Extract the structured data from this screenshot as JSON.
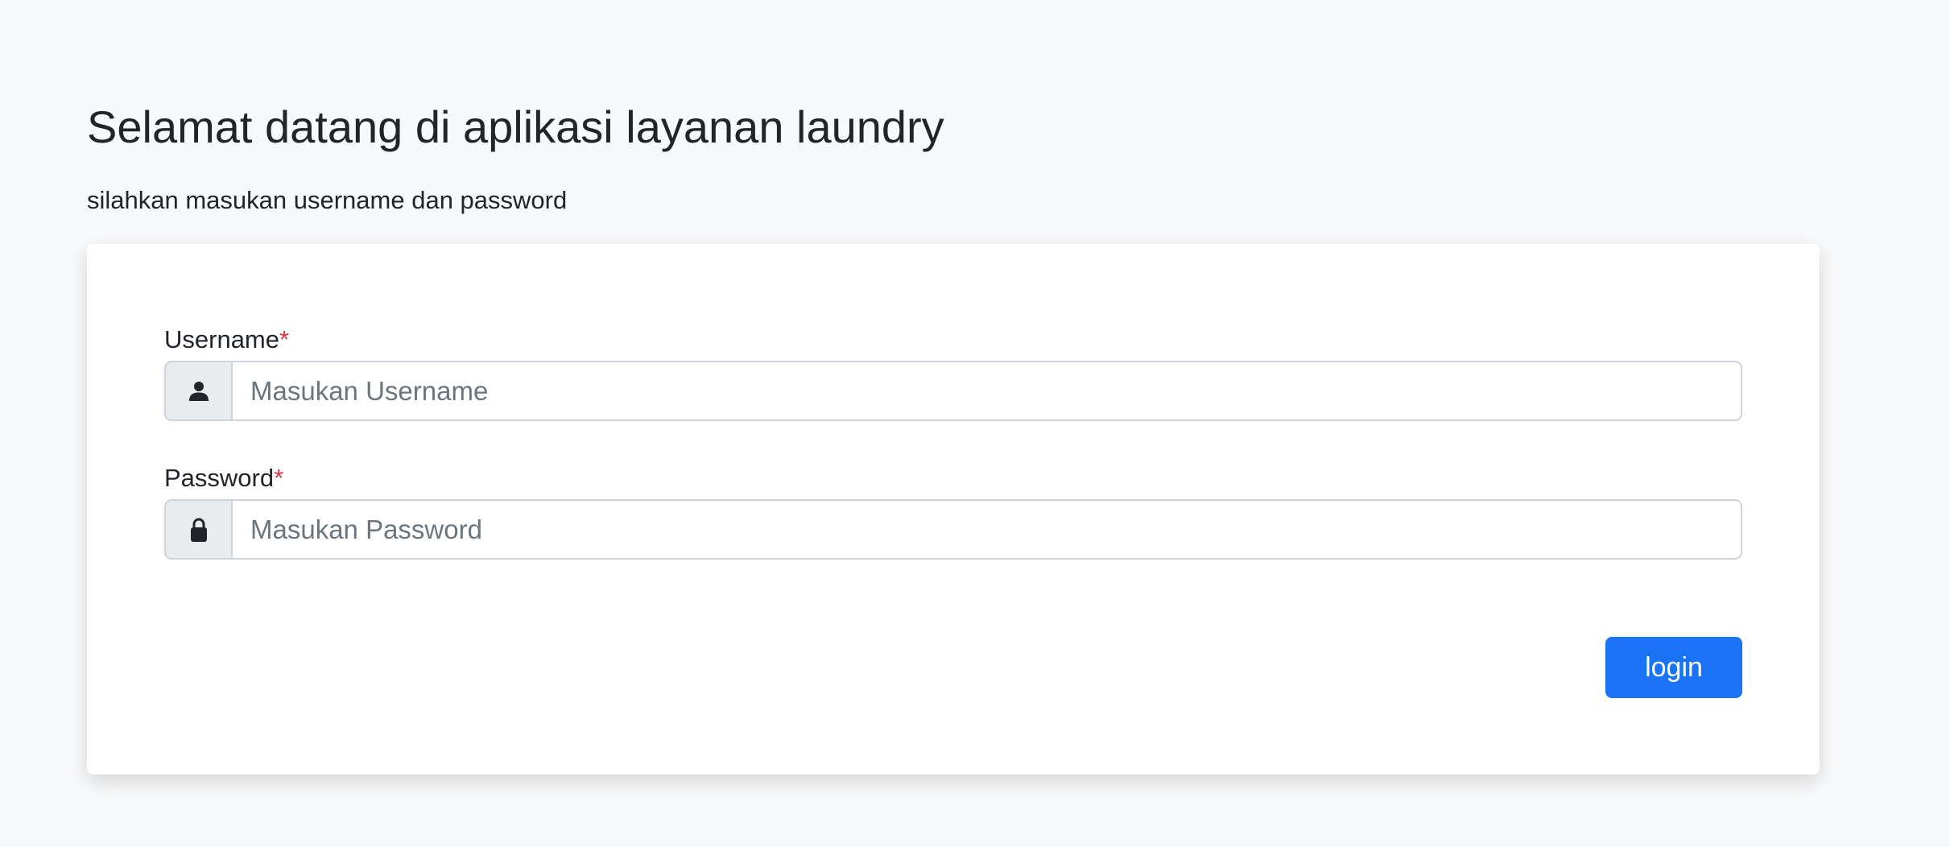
{
  "page": {
    "title": "Selamat datang di aplikasi layanan laundry",
    "subtitle": "silahkan masukan username dan password"
  },
  "form": {
    "username": {
      "label": "Username",
      "required_mark": "*",
      "icon": "user-icon",
      "value": "",
      "placeholder": "Masukan Username"
    },
    "password": {
      "label": "Password",
      "required_mark": "*",
      "icon": "lock-icon",
      "value": "",
      "placeholder": "Masukan Password"
    },
    "login_label": "login"
  },
  "colors": {
    "background": "#f8f9fa",
    "card": "#ffffff",
    "primary": "#1a73f5",
    "required": "#dc3545",
    "addon": "#e9ecef",
    "border": "#ced4da",
    "text": "#212529",
    "placeholder": "#6c757d"
  }
}
